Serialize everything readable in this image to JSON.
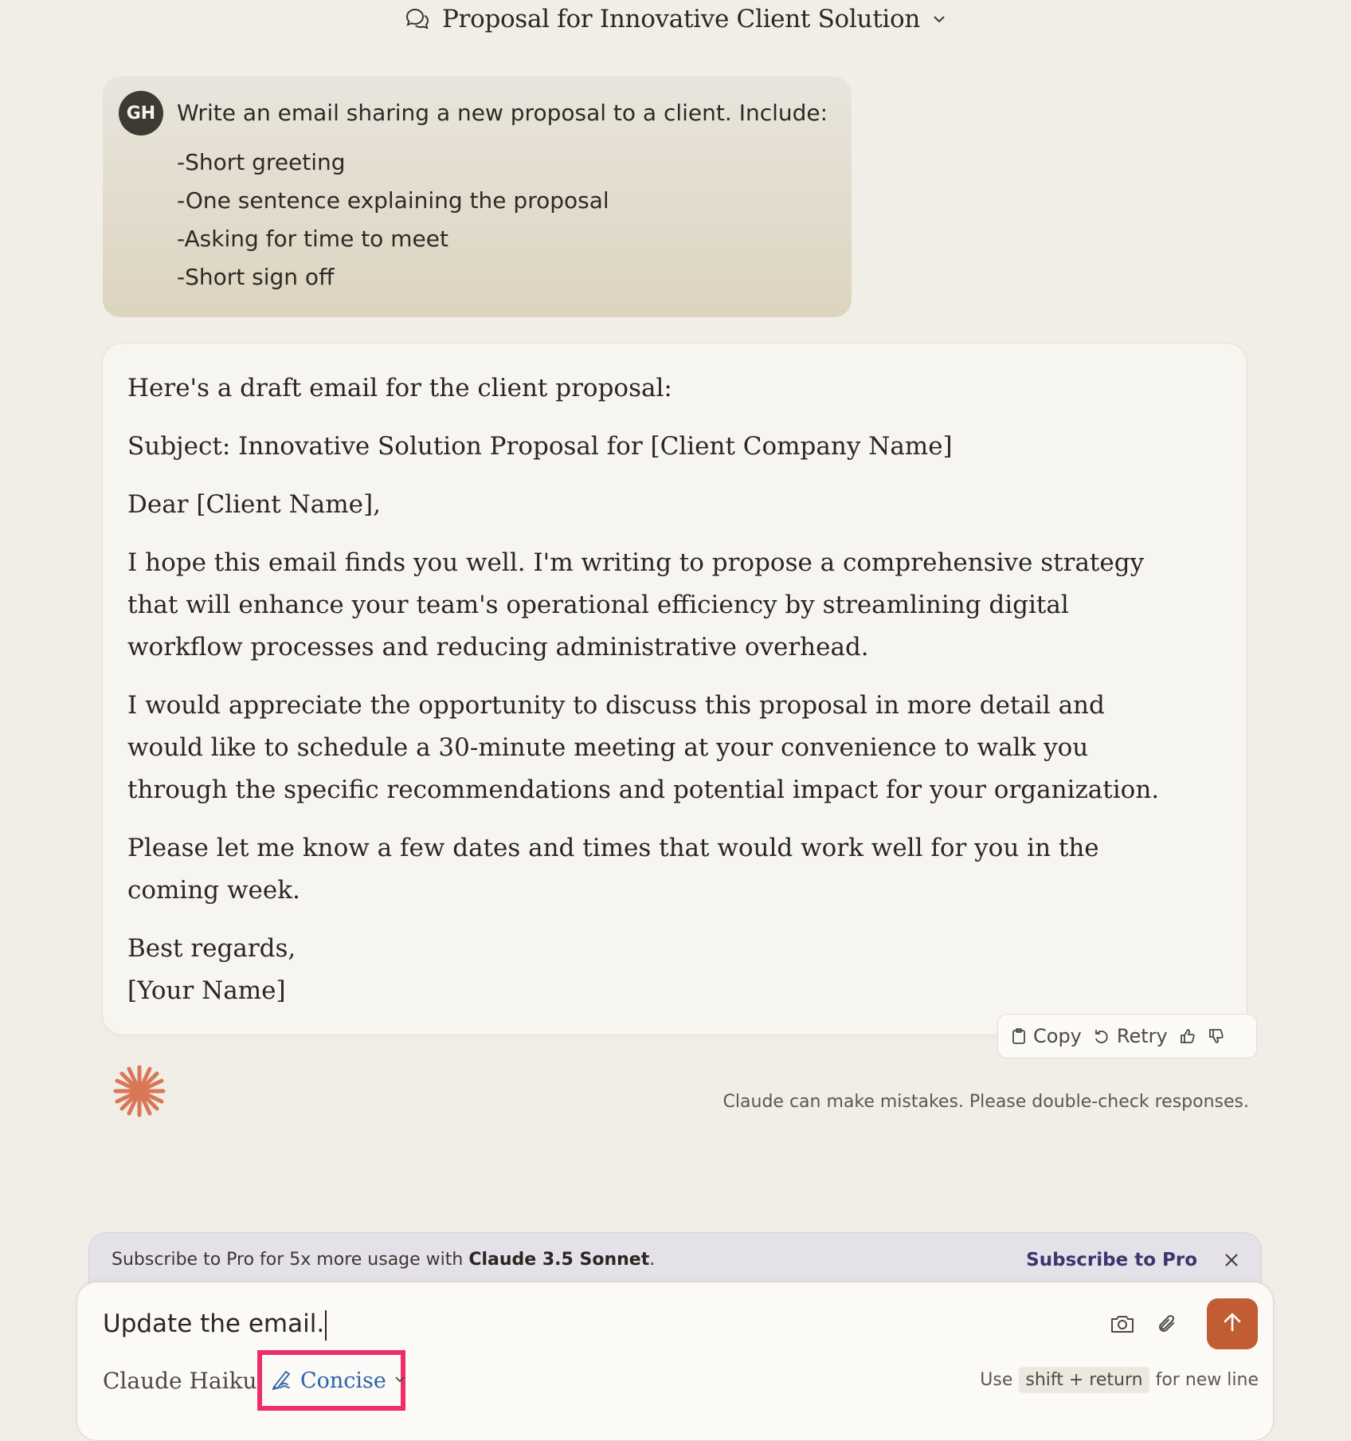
{
  "header": {
    "title": "Proposal for Innovative Client Solution"
  },
  "user_message": {
    "avatar_initials": "GH",
    "intro": "Write an email sharing a new proposal to a client. Include:",
    "items": [
      "-Short greeting",
      "-One sentence explaining the proposal",
      "-Asking for time to meet",
      "-Short sign off"
    ]
  },
  "assistant_message": {
    "intro": "Here's a draft email for the client proposal:",
    "subject": "Subject: Innovative Solution Proposal for [Client Company Name]",
    "greeting": "Dear [Client Name],",
    "paragraph1": "I hope this email finds you well. I'm writing to propose a comprehensive strategy that will enhance your team's operational efficiency by streamlining digital workflow processes and reducing administrative overhead.",
    "paragraph2": "I would appreciate the opportunity to discuss this proposal in more detail and would like to schedule a 30-minute meeting at your convenience to walk you through the specific recommendations and potential impact for your organization.",
    "paragraph3": "Please let me know a few dates and times that would work well for you in the coming week.",
    "signoff": "Best regards,",
    "name": "[Your Name]"
  },
  "actions": {
    "copy_label": "Copy",
    "retry_label": "Retry"
  },
  "disclaimer": "Claude can make mistakes. Please double-check responses.",
  "banner": {
    "text_prefix": "Subscribe to Pro for 5x more usage with ",
    "text_bold": "Claude 3.5 Sonnet",
    "text_suffix": ".",
    "cta": "Subscribe to Pro"
  },
  "composer": {
    "input_value": "Update the email.",
    "model": "Claude Haiku",
    "style": "Concise",
    "hint_prefix": "Use",
    "hint_keys": "shift + return",
    "hint_suffix": "for new line"
  },
  "colors": {
    "background": "#f1eee7",
    "send_button": "#c25d33",
    "highlight_box": "#ef2d6a",
    "style_label": "#2d62a6",
    "banner_cta": "#3a3670",
    "claude_logo": "#d97757"
  },
  "icons": {
    "header": "chat-bubbles-icon",
    "copy": "clipboard-icon",
    "retry": "retry-icon",
    "thumbs_up": "thumbs-up-icon",
    "thumbs_down": "thumbs-down-icon",
    "camera": "camera-icon",
    "attach": "paperclip-icon",
    "send": "arrow-up-icon",
    "style": "style-pen-icon"
  }
}
